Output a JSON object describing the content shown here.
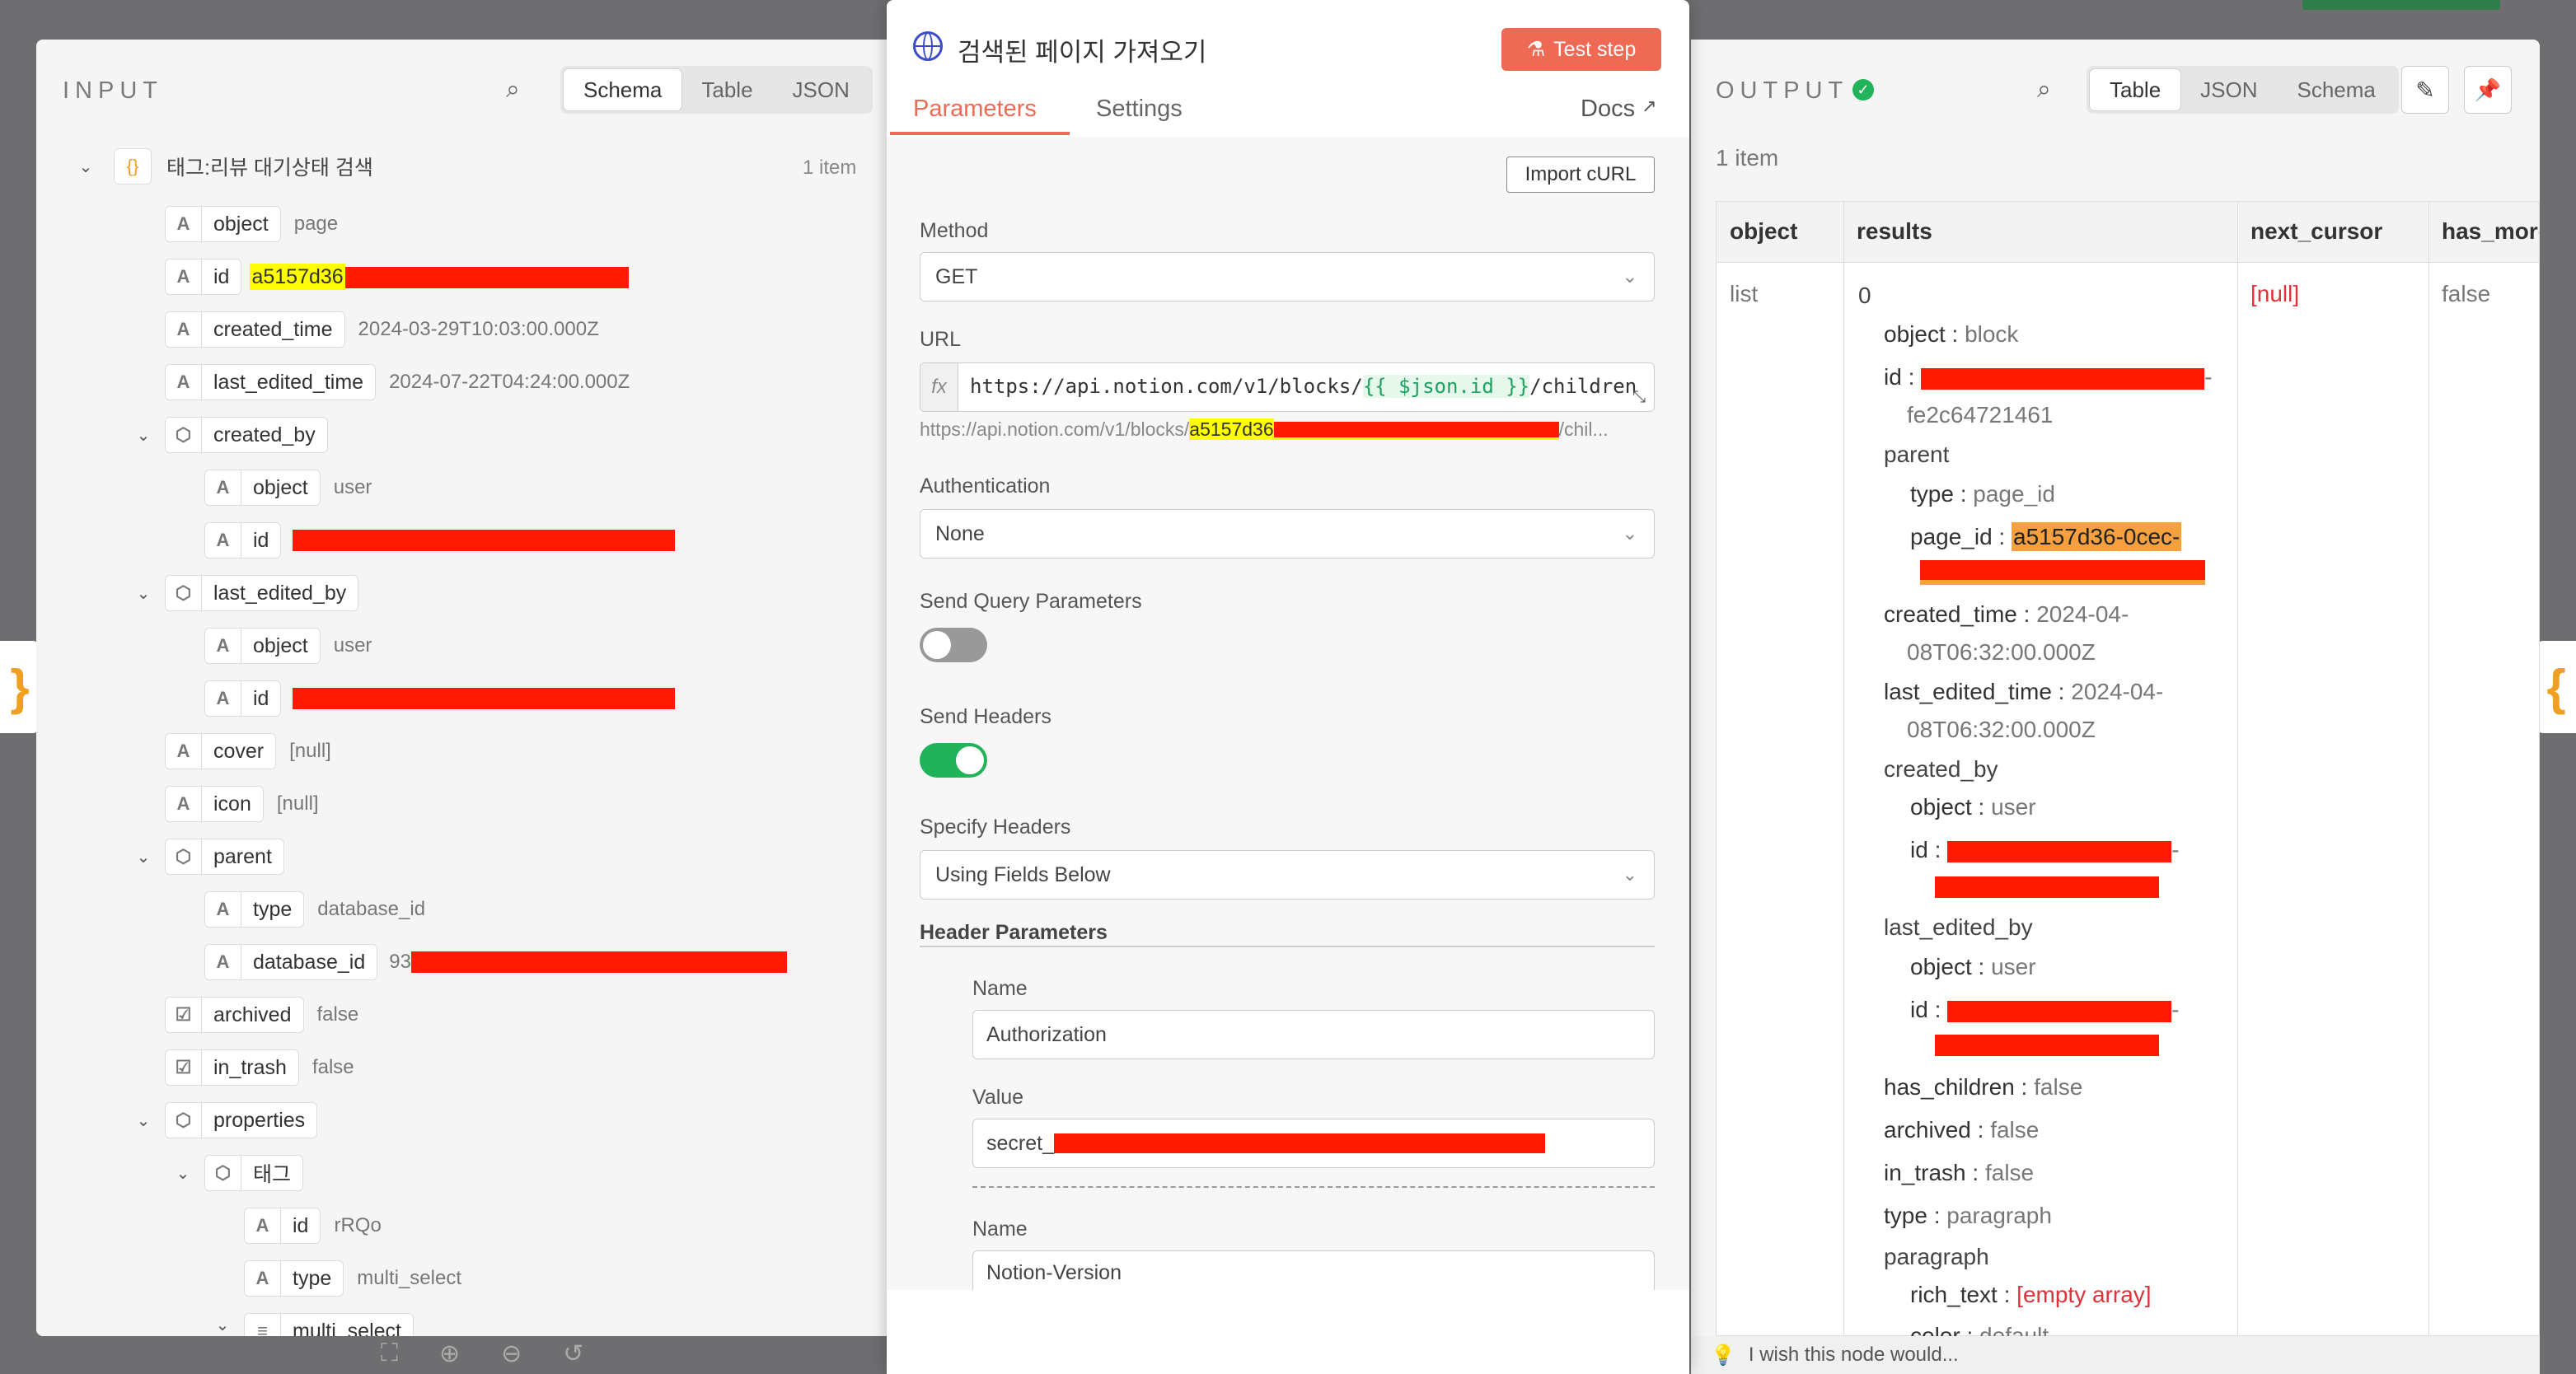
{
  "node": {
    "title": "검색된 페이지 가져오기",
    "test_label": "Test step",
    "tabs": [
      "Parameters",
      "Settings"
    ],
    "docs": "Docs"
  },
  "input": {
    "title": "INPUT",
    "views": [
      "Schema",
      "Table",
      "JSON"
    ],
    "root": "태그:리뷰 대기상태 검색",
    "count": "1 item",
    "fields": {
      "object": "object",
      "object_v": "page",
      "id": "id",
      "id_v": "a5157d36",
      "created_time": "created_time",
      "created_time_v": "2024-03-29T10:03:00.000Z",
      "last_edited_time": "last_edited_time",
      "last_edited_time_v": "2024-07-22T04:24:00.000Z",
      "created_by": "created_by",
      "cb_object": "object",
      "cb_object_v": "user",
      "cb_id": "id",
      "last_edited_by": "last_edited_by",
      "leb_object": "object",
      "leb_object_v": "user",
      "leb_id": "id",
      "cover": "cover",
      "cover_v": "[null]",
      "icon": "icon",
      "icon_v": "[null]",
      "parent": "parent",
      "p_type": "type",
      "p_type_v": "database_id",
      "p_dbid": "database_id",
      "p_dbid_v": "93",
      "archived": "archived",
      "archived_v": "false",
      "in_trash": "in_trash",
      "in_trash_v": "false",
      "properties": "properties",
      "tag": "태그",
      "tag_id": "id",
      "tag_id_v": "rRQo",
      "tag_type": "type",
      "tag_type_v": "multi_select",
      "tag_ms": "multi_select"
    }
  },
  "params": {
    "import": "Import cURL",
    "method_label": "Method",
    "method": "GET",
    "url_label": "URL",
    "url_prefix": "https://api.notion.com/v1/blocks/",
    "url_expr": "{{ $json.id }}",
    "url_suffix": "/children",
    "url_preview_prefix": "https://api.notion.com/v1/blocks/",
    "url_preview_hl": "a5157d36",
    "url_preview_suffix": "/chil...",
    "auth_label": "Authentication",
    "auth": "None",
    "query_label": "Send Query Parameters",
    "headers_label": "Send Headers",
    "specify_label": "Specify Headers",
    "specify": "Using Fields Below",
    "header_params": "Header Parameters",
    "name_label": "Name",
    "h1_name": "Authorization",
    "value_label": "Value",
    "h1_value": "secret_",
    "name2_label": "Name",
    "h2_name": "Notion-Version",
    "fx": "fx"
  },
  "output": {
    "title": "OUTPUT",
    "views": [
      "Table",
      "JSON",
      "Schema"
    ],
    "count": "1 item",
    "columns": [
      "object",
      "results",
      "next_cursor",
      "has_more"
    ],
    "row": {
      "object": "list",
      "index": "0",
      "next_cursor": "[null]",
      "has_more": "false"
    },
    "r": {
      "object_k": "object",
      "object_v": "block",
      "id_k": "id",
      "id_tail": "fe2c64721461",
      "parent_k": "parent",
      "type_k": "type",
      "type_v": "page_id",
      "page_id_k": "page_id",
      "page_id_v": "a5157d36-0cec-",
      "created_time_k": "created_time",
      "created_time_v1": "2024-04-",
      "created_time_v2": "08T06:32:00.000Z",
      "last_edited_time_k": "last_edited_time",
      "last_edited_time_v1": "2024-04-",
      "last_edited_time_v2": "08T06:32:00.000Z",
      "created_by_k": "created_by",
      "cb_object_k": "object",
      "cb_object_v": "user",
      "cb_id_k": "id",
      "last_edited_by_k": "last_edited_by",
      "leb_object_k": "object",
      "leb_object_v": "user",
      "leb_id_k": "id",
      "has_children_k": "has_children",
      "has_children_v": "false",
      "archived_k": "archived",
      "archived_v": "false",
      "in_trash_k": "in_trash",
      "in_trash_v": "false",
      "type2_k": "type",
      "type2_v": "paragraph",
      "paragraph_k": "paragraph",
      "rich_text_k": "rich_text",
      "rich_text_v": "[empty array]",
      "color_k": "color",
      "color_v": "default"
    }
  },
  "feedback": "I wish this node would...",
  "colors": {
    "accent": "#ee6a55",
    "success": "#20b35a",
    "redact": "#ff1a00",
    "highlight": "#ffff00",
    "orange_hl": "#f7a040"
  }
}
